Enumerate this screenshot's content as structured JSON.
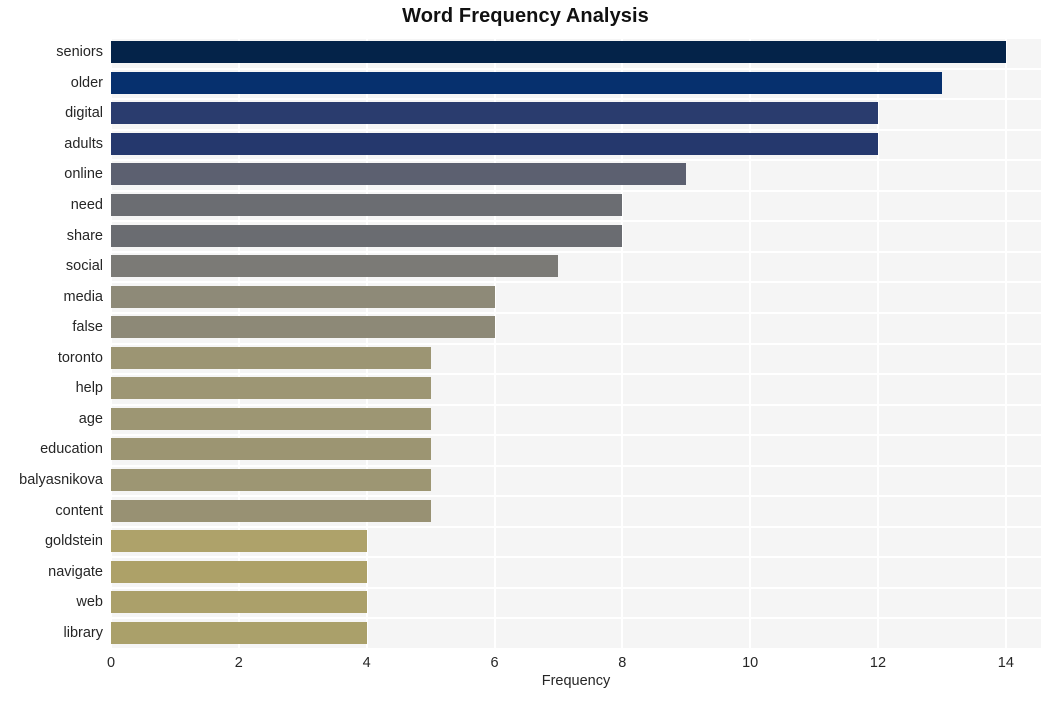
{
  "chart_data": {
    "type": "bar",
    "orientation": "horizontal",
    "title": "Word Frequency Analysis",
    "xlabel": "Frequency",
    "ylabel": "",
    "categories": [
      "seniors",
      "older",
      "digital",
      "adults",
      "online",
      "need",
      "share",
      "social",
      "media",
      "false",
      "toronto",
      "help",
      "age",
      "education",
      "balyasnikova",
      "content",
      "goldstein",
      "navigate",
      "web",
      "library"
    ],
    "values": [
      14,
      13,
      12,
      12,
      9,
      8,
      8,
      7,
      6,
      6,
      5,
      5,
      5,
      5,
      5,
      5,
      4,
      4,
      4,
      4
    ],
    "xticks": [
      0,
      2,
      4,
      6,
      8,
      10,
      12,
      14
    ],
    "xtick_labels": [
      "0",
      "2",
      "4",
      "6",
      "8",
      "10",
      "12",
      "14"
    ],
    "xlim": [
      0,
      14.55
    ],
    "grid": true,
    "legend": null,
    "bar_colors": [
      "#042349",
      "#06306e",
      "#2a3c6e",
      "#25386d",
      "#5c6070",
      "#6b6d72",
      "#6a6c71",
      "#7b7a76",
      "#8e8a78",
      "#8d8977",
      "#9c9573",
      "#9d9674",
      "#9d9673",
      "#9c9572",
      "#9d9673",
      "#989173",
      "#aea26a",
      "#ada168",
      "#aba06a",
      "#aaa06a"
    ],
    "plot_background": "#f5f5f5",
    "grid_color": "#ffffff",
    "figure_background": "#ffffff"
  }
}
